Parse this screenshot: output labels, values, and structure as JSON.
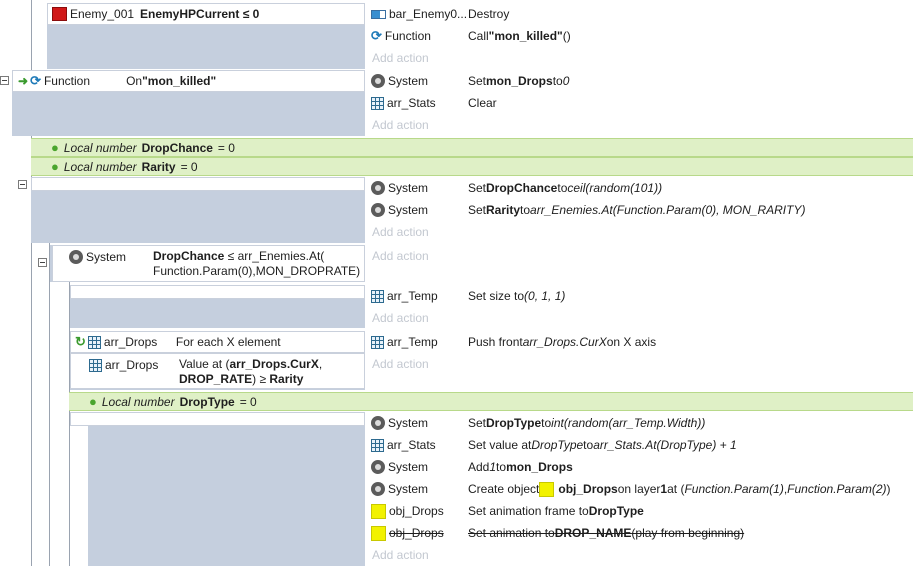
{
  "block1": {
    "cond_object": "Enemy_001",
    "cond_text": "EnemyHPCurrent ≤ 0",
    "actions": [
      {
        "object": "bar_Enemy0...",
        "icon": "bar-icon",
        "text": "Destroy"
      },
      {
        "object": "Function",
        "icon": "function-icon",
        "pre": "Call ",
        "bold": "\"mon_killed\"",
        "post": " ()"
      }
    ],
    "add_action": "Add action"
  },
  "block2": {
    "cond_object": "Function",
    "cond_pre": "On ",
    "cond_bold": "\"mon_killed\"",
    "actions": [
      {
        "object": "System",
        "icon": "gear-icon",
        "pre": "Set ",
        "bold": "mon_Drops",
        "mid": " to ",
        "ital": "0"
      },
      {
        "object": "arr_Stats",
        "icon": "grid-icon",
        "text": "Clear"
      }
    ],
    "add_action": "Add action"
  },
  "locals": [
    {
      "prefix": "Local number",
      "name": "DropChance",
      "value": "= 0"
    },
    {
      "prefix": "Local number",
      "name": "Rarity",
      "value": "= 0"
    }
  ],
  "block3": {
    "actions": [
      {
        "object": "System",
        "pre": "Set ",
        "bold": "DropChance",
        "mid": " to ",
        "ital": "ceil(random(101))"
      },
      {
        "object": "System",
        "pre": "Set ",
        "bold": "Rarity",
        "mid": " to ",
        "ital": "arr_Enemies.At(Function.Param(0), MON_RARITY)"
      }
    ],
    "add_action": "Add action"
  },
  "block4": {
    "cond_object": "System",
    "cond_line1_bold": "DropChance",
    "cond_line1_rest": " ≤ arr_Enemies.At(",
    "cond_line2": "Function.Param(0),MON_DROPRATE)",
    "add_action": "Add action"
  },
  "block5": {
    "action_object": "arr_Temp",
    "action_pre": "Set size to ",
    "action_ital": "(0, 1, 1)",
    "add_action": "Add action"
  },
  "block6": {
    "cond1_object": "arr_Drops",
    "cond1_text": "For each X element",
    "cond2_object": "arr_Drops",
    "cond2_line1_pre": "Value at (",
    "cond2_line1_bold": "arr_Drops.CurX",
    "cond2_line1_post": ",",
    "cond2_line2_bold": "DROP_RATE",
    "cond2_line2_mid": ") ≥ ",
    "cond2_line2_bold2": "Rarity",
    "action_object": "arr_Temp",
    "action_pre": "Push front ",
    "action_ital": "arr_Drops.CurX",
    "action_post": " on X axis",
    "add_action": "Add action"
  },
  "local3": {
    "prefix": "Local number",
    "name": "DropType",
    "value": "= 0"
  },
  "block7": {
    "a1": {
      "object": "System",
      "pre": "Set ",
      "bold": "DropType",
      "mid": " to ",
      "ital": "int(random(arr_Temp.Width))"
    },
    "a2": {
      "object": "arr_Stats",
      "pre": "Set value at ",
      "ital1": "DropType",
      "mid": " to ",
      "ital2": "arr_Stats.At(DropType) + 1"
    },
    "a3": {
      "object": "System",
      "pre": "Add ",
      "ital": "1",
      "mid": " to ",
      "bold": "mon_Drops"
    },
    "a4": {
      "object": "System",
      "pre": "Create object ",
      "bold1": "obj_Drops",
      "mid": " on layer ",
      "bold2": "1",
      "mid2": " at (",
      "ital1": "Function.Param(1)",
      "sep": " , ",
      "ital2": "Function.Param(2)",
      "post": " )"
    },
    "a5": {
      "object": "obj_Drops",
      "pre": "Set animation frame to ",
      "bold": "DropType"
    },
    "a6": {
      "object": "obj_Drops",
      "pre": "Set animation to ",
      "bold": "DROP_NAME",
      "post": " (play from beginning)",
      "disabled": true
    },
    "add_action": "Add action"
  },
  "colors": {
    "event_bg": "#c5cfde",
    "local_bg": "#dff0c6",
    "add_action": "#c3c8d0",
    "highlight": "#f2f200"
  }
}
